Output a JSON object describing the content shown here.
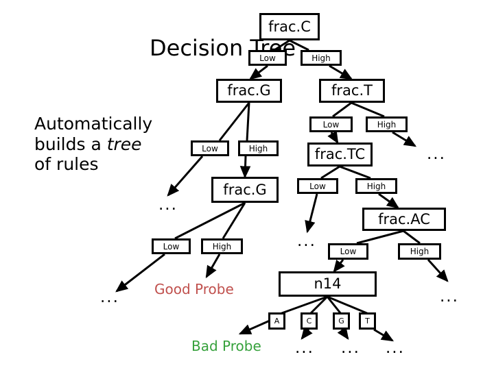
{
  "slide": {
    "title": "Decision Tree",
    "body_line1": "Automatically",
    "body_line2_pre": "builds a ",
    "body_line2_em": "tree",
    "body_line3": "of rules",
    "ellipsis": "..."
  },
  "colors": {
    "good_probe": "#c0504d",
    "bad_probe": "#36a13c",
    "node_border": "#000000",
    "background": "#ffffff",
    "edge": "#000000"
  },
  "nodes": {
    "frac_c": "frac.C",
    "frac_c_low": "Low",
    "frac_c_high": "High",
    "frac_g": "frac.G",
    "frac_t": "frac.T",
    "frac_g_low": "Low",
    "frac_g_high": "High",
    "frac_g2": "frac.G",
    "frac_t_low": "Low",
    "frac_t_high": "High",
    "frac_tc": "frac.TC",
    "frac_tc_low": "Low",
    "frac_tc_high": "High",
    "frac_ac": "frac.AC",
    "frac_g2_low": "Low",
    "frac_g2_high": "High",
    "frac_ac_low": "Low",
    "frac_ac_high": "High",
    "n14": "n14",
    "n14_a": "A",
    "n14_c": "C",
    "n14_g": "G",
    "n14_t": "T"
  },
  "leaves": {
    "good_probe": "Good Probe",
    "bad_probe": "Bad Probe"
  },
  "ellipses": {
    "e1": "...",
    "e2": "...",
    "e3": "...",
    "e4": "...",
    "e5": "...",
    "e6": "...",
    "e7": "...",
    "e8": "...",
    "e9": "..."
  }
}
